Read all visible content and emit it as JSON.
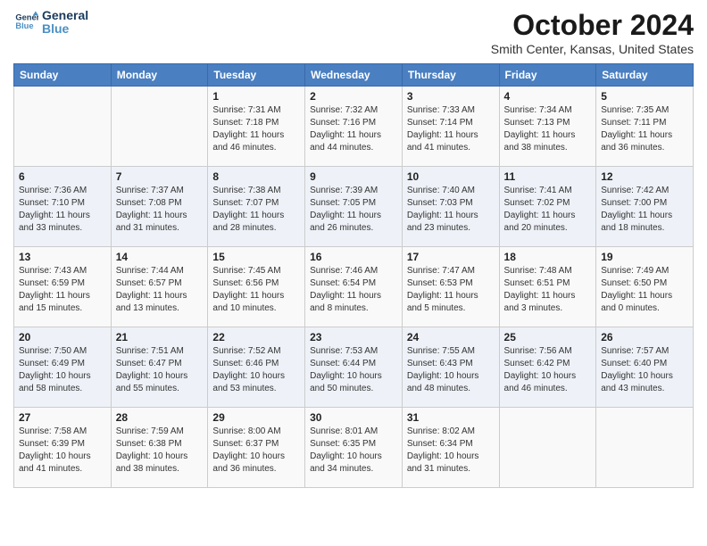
{
  "header": {
    "logo_line1": "General",
    "logo_line2": "Blue",
    "title": "October 2024",
    "location": "Smith Center, Kansas, United States"
  },
  "columns": [
    "Sunday",
    "Monday",
    "Tuesday",
    "Wednesday",
    "Thursday",
    "Friday",
    "Saturday"
  ],
  "weeks": [
    [
      {
        "day": "",
        "info": ""
      },
      {
        "day": "",
        "info": ""
      },
      {
        "day": "1",
        "info": "Sunrise: 7:31 AM\nSunset: 7:18 PM\nDaylight: 11 hours and 46 minutes."
      },
      {
        "day": "2",
        "info": "Sunrise: 7:32 AM\nSunset: 7:16 PM\nDaylight: 11 hours and 44 minutes."
      },
      {
        "day": "3",
        "info": "Sunrise: 7:33 AM\nSunset: 7:14 PM\nDaylight: 11 hours and 41 minutes."
      },
      {
        "day": "4",
        "info": "Sunrise: 7:34 AM\nSunset: 7:13 PM\nDaylight: 11 hours and 38 minutes."
      },
      {
        "day": "5",
        "info": "Sunrise: 7:35 AM\nSunset: 7:11 PM\nDaylight: 11 hours and 36 minutes."
      }
    ],
    [
      {
        "day": "6",
        "info": "Sunrise: 7:36 AM\nSunset: 7:10 PM\nDaylight: 11 hours and 33 minutes."
      },
      {
        "day": "7",
        "info": "Sunrise: 7:37 AM\nSunset: 7:08 PM\nDaylight: 11 hours and 31 minutes."
      },
      {
        "day": "8",
        "info": "Sunrise: 7:38 AM\nSunset: 7:07 PM\nDaylight: 11 hours and 28 minutes."
      },
      {
        "day": "9",
        "info": "Sunrise: 7:39 AM\nSunset: 7:05 PM\nDaylight: 11 hours and 26 minutes."
      },
      {
        "day": "10",
        "info": "Sunrise: 7:40 AM\nSunset: 7:03 PM\nDaylight: 11 hours and 23 minutes."
      },
      {
        "day": "11",
        "info": "Sunrise: 7:41 AM\nSunset: 7:02 PM\nDaylight: 11 hours and 20 minutes."
      },
      {
        "day": "12",
        "info": "Sunrise: 7:42 AM\nSunset: 7:00 PM\nDaylight: 11 hours and 18 minutes."
      }
    ],
    [
      {
        "day": "13",
        "info": "Sunrise: 7:43 AM\nSunset: 6:59 PM\nDaylight: 11 hours and 15 minutes."
      },
      {
        "day": "14",
        "info": "Sunrise: 7:44 AM\nSunset: 6:57 PM\nDaylight: 11 hours and 13 minutes."
      },
      {
        "day": "15",
        "info": "Sunrise: 7:45 AM\nSunset: 6:56 PM\nDaylight: 11 hours and 10 minutes."
      },
      {
        "day": "16",
        "info": "Sunrise: 7:46 AM\nSunset: 6:54 PM\nDaylight: 11 hours and 8 minutes."
      },
      {
        "day": "17",
        "info": "Sunrise: 7:47 AM\nSunset: 6:53 PM\nDaylight: 11 hours and 5 minutes."
      },
      {
        "day": "18",
        "info": "Sunrise: 7:48 AM\nSunset: 6:51 PM\nDaylight: 11 hours and 3 minutes."
      },
      {
        "day": "19",
        "info": "Sunrise: 7:49 AM\nSunset: 6:50 PM\nDaylight: 11 hours and 0 minutes."
      }
    ],
    [
      {
        "day": "20",
        "info": "Sunrise: 7:50 AM\nSunset: 6:49 PM\nDaylight: 10 hours and 58 minutes."
      },
      {
        "day": "21",
        "info": "Sunrise: 7:51 AM\nSunset: 6:47 PM\nDaylight: 10 hours and 55 minutes."
      },
      {
        "day": "22",
        "info": "Sunrise: 7:52 AM\nSunset: 6:46 PM\nDaylight: 10 hours and 53 minutes."
      },
      {
        "day": "23",
        "info": "Sunrise: 7:53 AM\nSunset: 6:44 PM\nDaylight: 10 hours and 50 minutes."
      },
      {
        "day": "24",
        "info": "Sunrise: 7:55 AM\nSunset: 6:43 PM\nDaylight: 10 hours and 48 minutes."
      },
      {
        "day": "25",
        "info": "Sunrise: 7:56 AM\nSunset: 6:42 PM\nDaylight: 10 hours and 46 minutes."
      },
      {
        "day": "26",
        "info": "Sunrise: 7:57 AM\nSunset: 6:40 PM\nDaylight: 10 hours and 43 minutes."
      }
    ],
    [
      {
        "day": "27",
        "info": "Sunrise: 7:58 AM\nSunset: 6:39 PM\nDaylight: 10 hours and 41 minutes."
      },
      {
        "day": "28",
        "info": "Sunrise: 7:59 AM\nSunset: 6:38 PM\nDaylight: 10 hours and 38 minutes."
      },
      {
        "day": "29",
        "info": "Sunrise: 8:00 AM\nSunset: 6:37 PM\nDaylight: 10 hours and 36 minutes."
      },
      {
        "day": "30",
        "info": "Sunrise: 8:01 AM\nSunset: 6:35 PM\nDaylight: 10 hours and 34 minutes."
      },
      {
        "day": "31",
        "info": "Sunrise: 8:02 AM\nSunset: 6:34 PM\nDaylight: 10 hours and 31 minutes."
      },
      {
        "day": "",
        "info": ""
      },
      {
        "day": "",
        "info": ""
      }
    ]
  ]
}
